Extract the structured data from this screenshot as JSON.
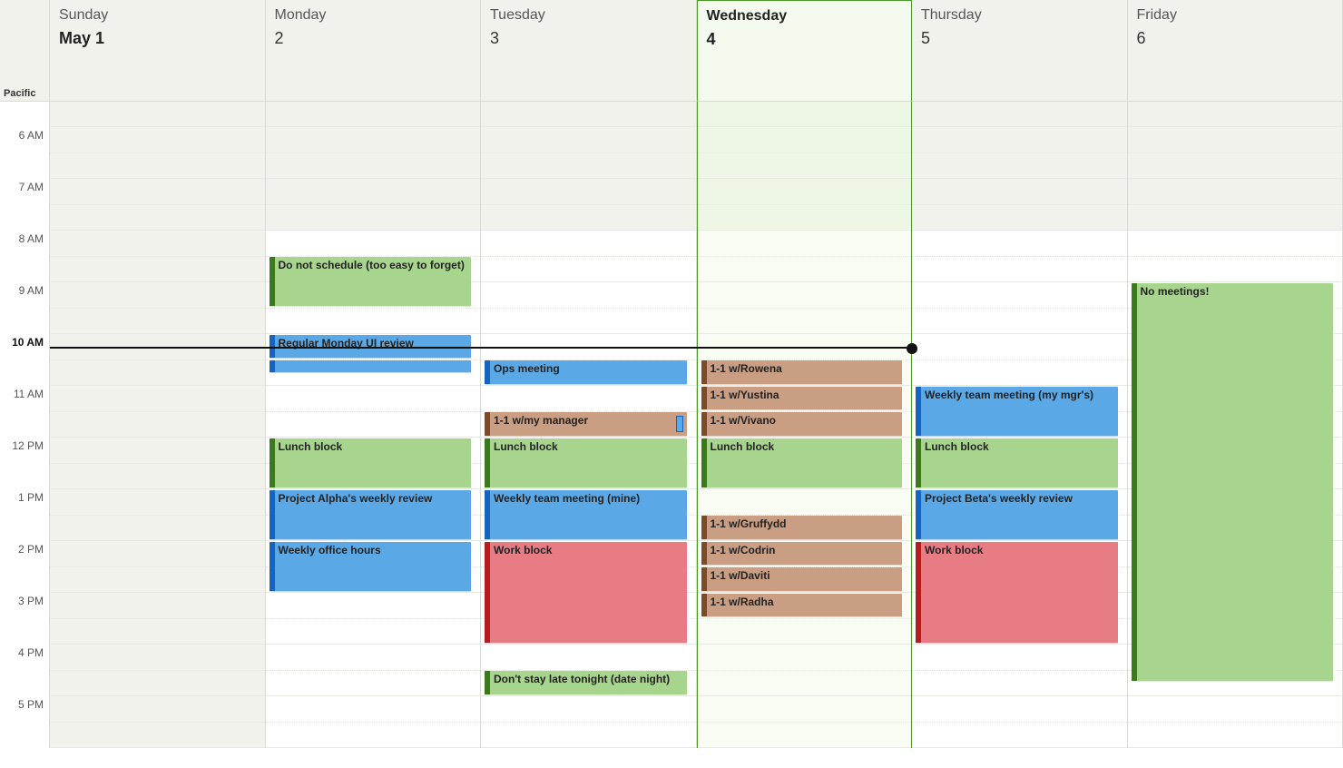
{
  "timezone_label": "Pacific",
  "hours": [
    {
      "label": "",
      "spacer": true
    },
    {
      "label": "6 AM",
      "nonwork": true
    },
    {
      "label": "7 AM",
      "nonwork": true
    },
    {
      "label": "8 AM"
    },
    {
      "label": "9 AM"
    },
    {
      "label": "10 AM",
      "now": true
    },
    {
      "label": "11 AM"
    },
    {
      "label": "12 PM"
    },
    {
      "label": "1 PM"
    },
    {
      "label": "2 PM"
    },
    {
      "label": "3 PM"
    },
    {
      "label": "4 PM"
    },
    {
      "label": "5 PM"
    }
  ],
  "now_hour_index": 5,
  "now_fraction": 0.25,
  "today_index": 3,
  "days": [
    {
      "name": "Sunday",
      "date": "May 1",
      "first": true,
      "all_nonwork": true,
      "events": []
    },
    {
      "name": "Monday",
      "date": "2",
      "events": [
        {
          "title": "Do not schedule (too easy to forget)",
          "color": "green",
          "start": 8.5,
          "end": 9.5,
          "big": true
        },
        {
          "title": "Regular Monday UI review",
          "color": "blue",
          "start": 10,
          "end": 10.5
        },
        {
          "title": "",
          "color": "blue",
          "start": 10.5,
          "end": 10.75
        },
        {
          "title": "Lunch block",
          "color": "green",
          "start": 12,
          "end": 13
        },
        {
          "title": "Project Alpha's weekly review",
          "color": "blue",
          "start": 13,
          "end": 14
        },
        {
          "title": "Weekly office hours",
          "color": "blue",
          "start": 14,
          "end": 15
        }
      ]
    },
    {
      "name": "Tuesday",
      "date": "3",
      "events": [
        {
          "title": "Ops meeting",
          "color": "blue",
          "start": 10.5,
          "end": 11
        },
        {
          "title": "1-1 w/my manager",
          "color": "brown",
          "start": 11.5,
          "end": 12,
          "marker": true
        },
        {
          "title": "Lunch block",
          "color": "green",
          "start": 12,
          "end": 13
        },
        {
          "title": "Weekly team meeting (mine)",
          "color": "blue",
          "start": 13,
          "end": 14
        },
        {
          "title": "Work block",
          "color": "red",
          "start": 14,
          "end": 16
        },
        {
          "title": "Don't stay late tonight (date night)",
          "color": "green",
          "start": 16.5,
          "end": 17
        }
      ]
    },
    {
      "name": "Wednesday",
      "date": "4",
      "today": true,
      "events": [
        {
          "title": "1-1 w/Rowena",
          "color": "brown",
          "start": 10.5,
          "end": 11
        },
        {
          "title": "1-1 w/Yustina",
          "color": "brown",
          "start": 11,
          "end": 11.5
        },
        {
          "title": "1-1 w/Vivano",
          "color": "brown",
          "start": 11.5,
          "end": 12
        },
        {
          "title": "Lunch block",
          "color": "green",
          "start": 12,
          "end": 13
        },
        {
          "title": "1-1 w/Gruffydd",
          "color": "brown",
          "start": 13.5,
          "end": 14
        },
        {
          "title": "1-1 w/Codrin",
          "color": "brown",
          "start": 14,
          "end": 14.5
        },
        {
          "title": "1-1 w/Daviti",
          "color": "brown",
          "start": 14.5,
          "end": 15
        },
        {
          "title": "1-1 w/Radha",
          "color": "brown",
          "start": 15,
          "end": 15.5
        }
      ]
    },
    {
      "name": "Thursday",
      "date": "5",
      "events": [
        {
          "title": "Weekly team meeting (my mgr's)",
          "color": "blue",
          "start": 11,
          "end": 12
        },
        {
          "title": "Lunch block",
          "color": "green",
          "start": 12,
          "end": 13
        },
        {
          "title": "Project Beta's weekly review",
          "color": "blue",
          "start": 13,
          "end": 14
        },
        {
          "title": "Work block",
          "color": "red",
          "start": 14,
          "end": 16
        }
      ]
    },
    {
      "name": "Friday",
      "date": "6",
      "events": [
        {
          "title": "No meetings!",
          "color": "green",
          "start": 9,
          "end": 16.75,
          "big": true
        }
      ]
    }
  ]
}
